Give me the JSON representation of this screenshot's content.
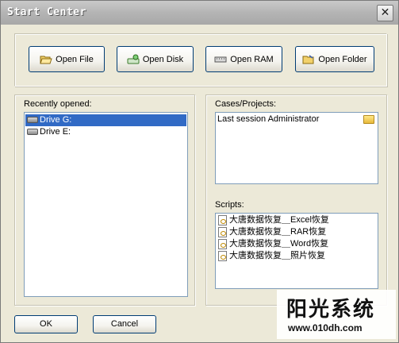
{
  "window": {
    "title": "Start Center",
    "close_glyph": "✕"
  },
  "toolbar": {
    "buttons": [
      {
        "label": "Open File",
        "icon": "open-folder-icon"
      },
      {
        "label": "Open Disk",
        "icon": "disk-icon"
      },
      {
        "label": "Open RAM",
        "icon": "ram-icon"
      },
      {
        "label": "Open Folder",
        "icon": "folder-icon"
      }
    ]
  },
  "recent": {
    "label": "Recently opened:",
    "items": [
      {
        "label": "Drive G:",
        "selected": true
      },
      {
        "label": "Drive E:",
        "selected": false
      }
    ]
  },
  "cases": {
    "label": "Cases/Projects:",
    "items": [
      {
        "label": "Last session Administrator"
      }
    ]
  },
  "scripts": {
    "label": "Scripts:",
    "items": [
      {
        "label": "大唐数据恢复＿Excel恢复"
      },
      {
        "label": "大唐数据恢复＿RAR恢复"
      },
      {
        "label": "大唐数据恢复＿Word恢复"
      },
      {
        "label": "大唐数据恢复＿照片恢复"
      }
    ]
  },
  "footer": {
    "ok_label": "OK",
    "cancel_label": "Cancel"
  },
  "watermark": {
    "title": "阳光系统",
    "url": "www.010dh.com"
  },
  "colors": {
    "selection": "#316ac5",
    "face": "#ece9d8",
    "button_border": "#003c74"
  }
}
